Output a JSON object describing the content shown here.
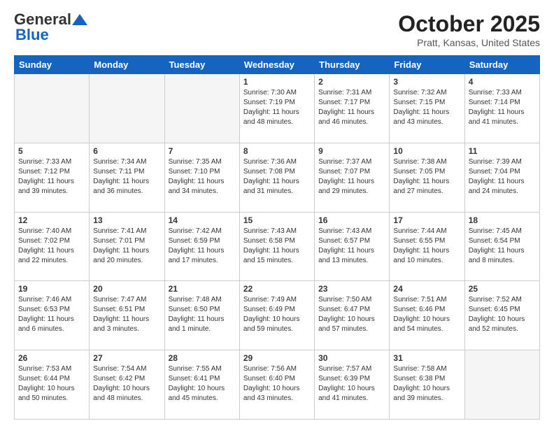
{
  "header": {
    "logo_general": "General",
    "logo_blue": "Blue",
    "title": "October 2025",
    "location": "Pratt, Kansas, United States"
  },
  "weekdays": [
    "Sunday",
    "Monday",
    "Tuesday",
    "Wednesday",
    "Thursday",
    "Friday",
    "Saturday"
  ],
  "weeks": [
    [
      {
        "day": "",
        "info": ""
      },
      {
        "day": "",
        "info": ""
      },
      {
        "day": "",
        "info": ""
      },
      {
        "day": "1",
        "info": "Sunrise: 7:30 AM\nSunset: 7:19 PM\nDaylight: 11 hours\nand 48 minutes."
      },
      {
        "day": "2",
        "info": "Sunrise: 7:31 AM\nSunset: 7:17 PM\nDaylight: 11 hours\nand 46 minutes."
      },
      {
        "day": "3",
        "info": "Sunrise: 7:32 AM\nSunset: 7:15 PM\nDaylight: 11 hours\nand 43 minutes."
      },
      {
        "day": "4",
        "info": "Sunrise: 7:33 AM\nSunset: 7:14 PM\nDaylight: 11 hours\nand 41 minutes."
      }
    ],
    [
      {
        "day": "5",
        "info": "Sunrise: 7:33 AM\nSunset: 7:12 PM\nDaylight: 11 hours\nand 39 minutes."
      },
      {
        "day": "6",
        "info": "Sunrise: 7:34 AM\nSunset: 7:11 PM\nDaylight: 11 hours\nand 36 minutes."
      },
      {
        "day": "7",
        "info": "Sunrise: 7:35 AM\nSunset: 7:10 PM\nDaylight: 11 hours\nand 34 minutes."
      },
      {
        "day": "8",
        "info": "Sunrise: 7:36 AM\nSunset: 7:08 PM\nDaylight: 11 hours\nand 31 minutes."
      },
      {
        "day": "9",
        "info": "Sunrise: 7:37 AM\nSunset: 7:07 PM\nDaylight: 11 hours\nand 29 minutes."
      },
      {
        "day": "10",
        "info": "Sunrise: 7:38 AM\nSunset: 7:05 PM\nDaylight: 11 hours\nand 27 minutes."
      },
      {
        "day": "11",
        "info": "Sunrise: 7:39 AM\nSunset: 7:04 PM\nDaylight: 11 hours\nand 24 minutes."
      }
    ],
    [
      {
        "day": "12",
        "info": "Sunrise: 7:40 AM\nSunset: 7:02 PM\nDaylight: 11 hours\nand 22 minutes."
      },
      {
        "day": "13",
        "info": "Sunrise: 7:41 AM\nSunset: 7:01 PM\nDaylight: 11 hours\nand 20 minutes."
      },
      {
        "day": "14",
        "info": "Sunrise: 7:42 AM\nSunset: 6:59 PM\nDaylight: 11 hours\nand 17 minutes."
      },
      {
        "day": "15",
        "info": "Sunrise: 7:43 AM\nSunset: 6:58 PM\nDaylight: 11 hours\nand 15 minutes."
      },
      {
        "day": "16",
        "info": "Sunrise: 7:43 AM\nSunset: 6:57 PM\nDaylight: 11 hours\nand 13 minutes."
      },
      {
        "day": "17",
        "info": "Sunrise: 7:44 AM\nSunset: 6:55 PM\nDaylight: 11 hours\nand 10 minutes."
      },
      {
        "day": "18",
        "info": "Sunrise: 7:45 AM\nSunset: 6:54 PM\nDaylight: 11 hours\nand 8 minutes."
      }
    ],
    [
      {
        "day": "19",
        "info": "Sunrise: 7:46 AM\nSunset: 6:53 PM\nDaylight: 11 hours\nand 6 minutes."
      },
      {
        "day": "20",
        "info": "Sunrise: 7:47 AM\nSunset: 6:51 PM\nDaylight: 11 hours\nand 3 minutes."
      },
      {
        "day": "21",
        "info": "Sunrise: 7:48 AM\nSunset: 6:50 PM\nDaylight: 11 hours\nand 1 minute."
      },
      {
        "day": "22",
        "info": "Sunrise: 7:49 AM\nSunset: 6:49 PM\nDaylight: 10 hours\nand 59 minutes."
      },
      {
        "day": "23",
        "info": "Sunrise: 7:50 AM\nSunset: 6:47 PM\nDaylight: 10 hours\nand 57 minutes."
      },
      {
        "day": "24",
        "info": "Sunrise: 7:51 AM\nSunset: 6:46 PM\nDaylight: 10 hours\nand 54 minutes."
      },
      {
        "day": "25",
        "info": "Sunrise: 7:52 AM\nSunset: 6:45 PM\nDaylight: 10 hours\nand 52 minutes."
      }
    ],
    [
      {
        "day": "26",
        "info": "Sunrise: 7:53 AM\nSunset: 6:44 PM\nDaylight: 10 hours\nand 50 minutes."
      },
      {
        "day": "27",
        "info": "Sunrise: 7:54 AM\nSunset: 6:42 PM\nDaylight: 10 hours\nand 48 minutes."
      },
      {
        "day": "28",
        "info": "Sunrise: 7:55 AM\nSunset: 6:41 PM\nDaylight: 10 hours\nand 45 minutes."
      },
      {
        "day": "29",
        "info": "Sunrise: 7:56 AM\nSunset: 6:40 PM\nDaylight: 10 hours\nand 43 minutes."
      },
      {
        "day": "30",
        "info": "Sunrise: 7:57 AM\nSunset: 6:39 PM\nDaylight: 10 hours\nand 41 minutes."
      },
      {
        "day": "31",
        "info": "Sunrise: 7:58 AM\nSunset: 6:38 PM\nDaylight: 10 hours\nand 39 minutes."
      },
      {
        "day": "",
        "info": ""
      }
    ]
  ]
}
